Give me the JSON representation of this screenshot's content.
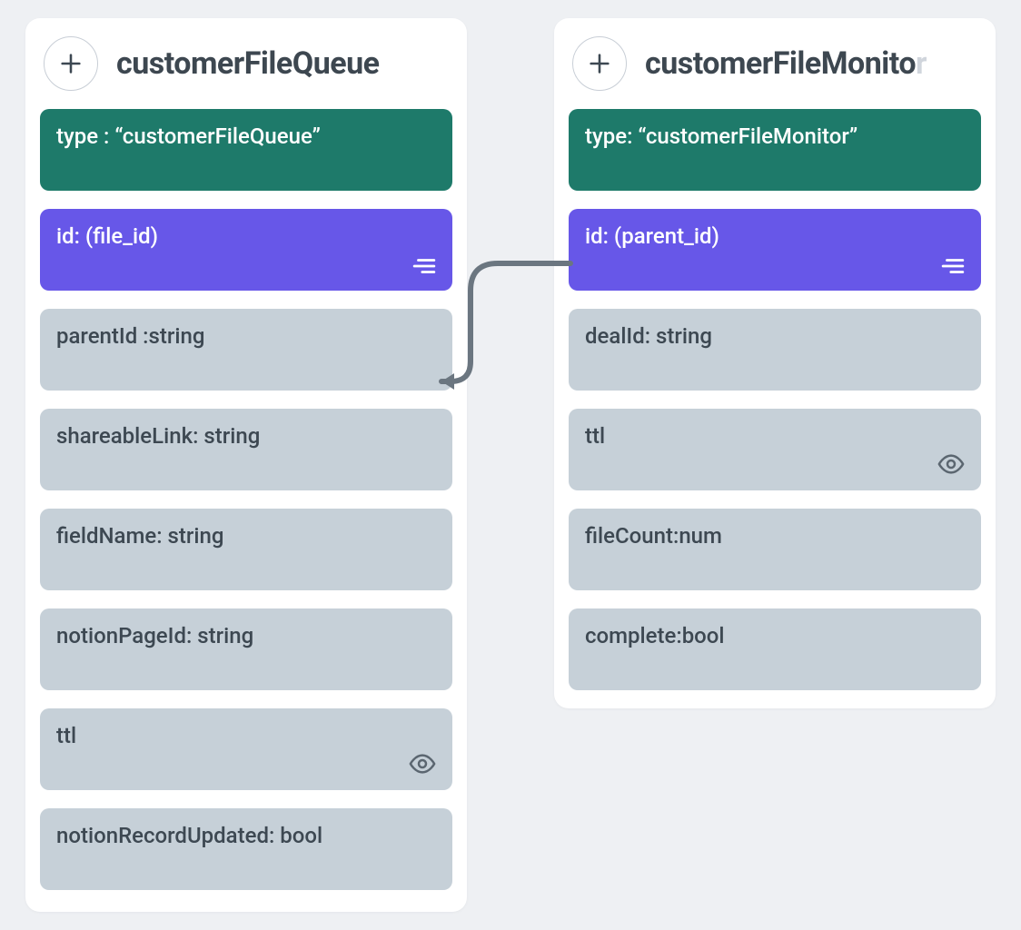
{
  "entities": [
    {
      "name": "customerFileQueue",
      "title_main": "customerFileQueue",
      "title_fade": "",
      "type_label": "type : “customerFileQueue”",
      "id_label": "id: (file_id)",
      "attrs": [
        {
          "label": "parentId :string",
          "icon": ""
        },
        {
          "label": "shareableLink: string",
          "icon": ""
        },
        {
          "label": "fieldName: string",
          "icon": ""
        },
        {
          "label": "notionPageId: string",
          "icon": ""
        },
        {
          "label": "ttl",
          "icon": "eye"
        },
        {
          "label": "notionRecordUpdated: bool",
          "icon": ""
        }
      ]
    },
    {
      "name": "customerFileMonitor",
      "title_main": "customerFileMonito",
      "title_fade": "r",
      "type_label": "type: “customerFileMonitor”",
      "id_label": "id: (parent_id)",
      "attrs": [
        {
          "label": "dealId: string",
          "icon": ""
        },
        {
          "label": "ttl",
          "icon": "eye"
        },
        {
          "label": "fileCount:num",
          "icon": ""
        },
        {
          "label": "complete:bool",
          "icon": ""
        }
      ]
    }
  ],
  "colors": {
    "type_bg": "#1e7a6a",
    "id_bg": "#6757e8",
    "attr_bg": "#c6d0d8",
    "canvas_bg": "#eef0f3",
    "connector": "#6b7680"
  }
}
